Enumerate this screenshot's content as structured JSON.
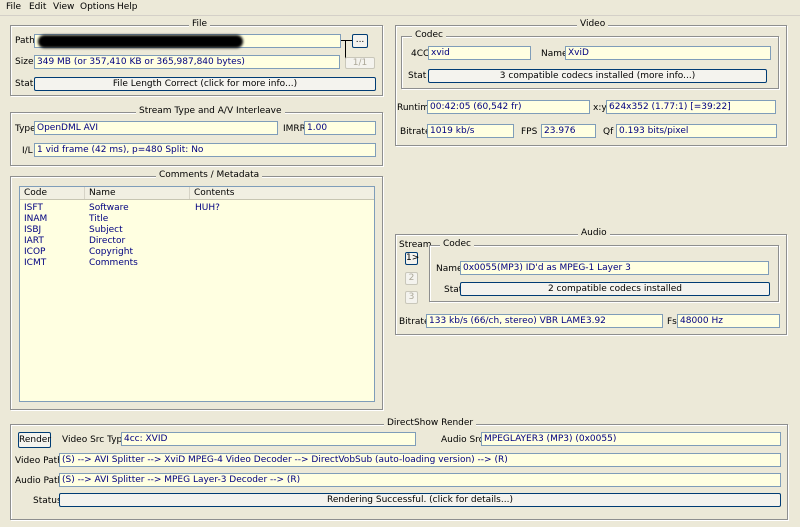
{
  "menu": [
    "File",
    "Edit",
    "View",
    "Options",
    "Help"
  ],
  "file": {
    "legend": "File",
    "path_label": "Path",
    "path_browse": "...",
    "size_label": "Size",
    "size_value": "349 MB (or 357,410 KB or 365,987,840 bytes)",
    "size_page": "1/1",
    "stat_label": "Stat",
    "stat_value": "File Length Correct (click for more info...)"
  },
  "stream": {
    "legend": "Stream Type and A/V Interleave",
    "type_label": "Type",
    "type_value": "OpenDML AVI",
    "imrr_label": "IMRR",
    "imrr_value": "1.00",
    "il_label": "I/L",
    "il_value": "1 vid frame (42 ms), p=480  Split: No"
  },
  "comments": {
    "legend": "Comments / Metadata",
    "columns": [
      "Code",
      "Name",
      "Contents"
    ],
    "rows": [
      {
        "code": "ISFT",
        "name": "Software",
        "contents": "HUH?"
      },
      {
        "code": "INAM",
        "name": "Title",
        "contents": ""
      },
      {
        "code": "ISBJ",
        "name": "Subject",
        "contents": ""
      },
      {
        "code": "IART",
        "name": "Director",
        "contents": ""
      },
      {
        "code": "ICOP",
        "name": "Copyright",
        "contents": ""
      },
      {
        "code": "ICMT",
        "name": "Comments",
        "contents": ""
      }
    ]
  },
  "video": {
    "legend": "Video",
    "codec_legend": "Codec",
    "fourcc_label": "4CC",
    "fourcc_value": "xvid",
    "name_label": "Name",
    "name_value": "XviD",
    "stat_label": "Stat",
    "stat_value": "3 compatible codecs installed (more info...)",
    "runtime_label": "Runtime",
    "runtime_value": "00:42:05 (60,542 fr)",
    "xy_label": "x:y",
    "xy_value": "624x352 (1.77:1) [=39:22]",
    "bitrate_label": "Bitrate",
    "bitrate_value": "1019 kb/s",
    "fps_label": "FPS",
    "fps_value": "23.976",
    "qf_label": "Qf",
    "qf_value": "0.193 bits/pixel"
  },
  "audio": {
    "legend": "Audio",
    "stream_label": "Stream",
    "stream_buttons": [
      "1>",
      "2",
      "3"
    ],
    "codec_legend": "Codec",
    "name_label": "Name",
    "name_value": "0x0055(MP3) ID'd as MPEG-1 Layer 3",
    "stat_label": "Stat",
    "stat_value": "2 compatible codecs installed",
    "bitrate_label": "Bitrate",
    "bitrate_value": "133 kb/s (66/ch, stereo) VBR LAME3.92",
    "fs_label": "Fs",
    "fs_value": "48000 Hz"
  },
  "directshow": {
    "legend": "DirectShow Render",
    "render_button": "Render",
    "video_src_type_label": "Video Src Type",
    "video_src_type_value": "4cc: XVID",
    "audio_src_label": "Audio Src",
    "audio_src_value": "MPEGLAYER3 (MP3) (0x0055)",
    "video_path_label": "Video Path",
    "video_path_value": "(S) --> AVI Splitter --> XviD MPEG-4 Video Decoder --> DirectVobSub (auto-loading version) --> (R)",
    "audio_path_label": "Audio Path",
    "audio_path_value": "(S) --> AVI Splitter --> MPEG Layer-3 Decoder --> (R)",
    "status_label": "Status",
    "status_value": "Rendering Successful.  (click for details...)"
  }
}
